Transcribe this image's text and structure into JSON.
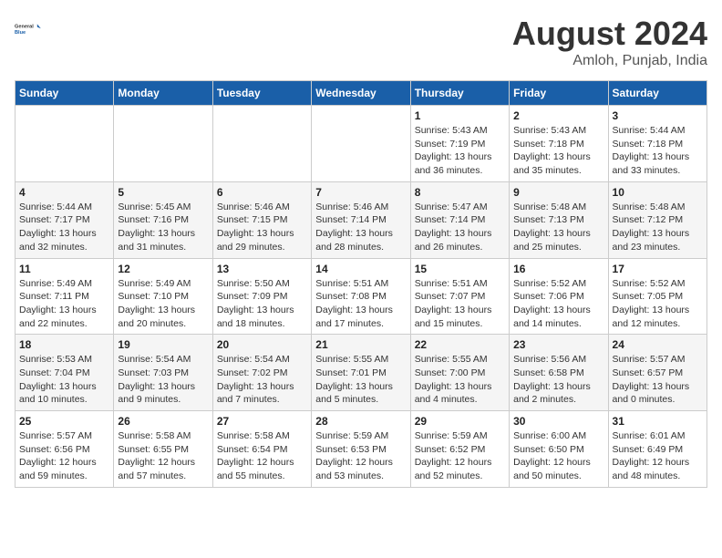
{
  "header": {
    "logo_general": "General",
    "logo_blue": "Blue",
    "title": "August 2024",
    "location": "Amloh, Punjab, India"
  },
  "days_of_week": [
    "Sunday",
    "Monday",
    "Tuesday",
    "Wednesday",
    "Thursday",
    "Friday",
    "Saturday"
  ],
  "weeks": [
    [
      {
        "day": "",
        "content": ""
      },
      {
        "day": "",
        "content": ""
      },
      {
        "day": "",
        "content": ""
      },
      {
        "day": "",
        "content": ""
      },
      {
        "day": "1",
        "content": "Sunrise: 5:43 AM\nSunset: 7:19 PM\nDaylight: 13 hours\nand 36 minutes."
      },
      {
        "day": "2",
        "content": "Sunrise: 5:43 AM\nSunset: 7:18 PM\nDaylight: 13 hours\nand 35 minutes."
      },
      {
        "day": "3",
        "content": "Sunrise: 5:44 AM\nSunset: 7:18 PM\nDaylight: 13 hours\nand 33 minutes."
      }
    ],
    [
      {
        "day": "4",
        "content": "Sunrise: 5:44 AM\nSunset: 7:17 PM\nDaylight: 13 hours\nand 32 minutes."
      },
      {
        "day": "5",
        "content": "Sunrise: 5:45 AM\nSunset: 7:16 PM\nDaylight: 13 hours\nand 31 minutes."
      },
      {
        "day": "6",
        "content": "Sunrise: 5:46 AM\nSunset: 7:15 PM\nDaylight: 13 hours\nand 29 minutes."
      },
      {
        "day": "7",
        "content": "Sunrise: 5:46 AM\nSunset: 7:14 PM\nDaylight: 13 hours\nand 28 minutes."
      },
      {
        "day": "8",
        "content": "Sunrise: 5:47 AM\nSunset: 7:14 PM\nDaylight: 13 hours\nand 26 minutes."
      },
      {
        "day": "9",
        "content": "Sunrise: 5:48 AM\nSunset: 7:13 PM\nDaylight: 13 hours\nand 25 minutes."
      },
      {
        "day": "10",
        "content": "Sunrise: 5:48 AM\nSunset: 7:12 PM\nDaylight: 13 hours\nand 23 minutes."
      }
    ],
    [
      {
        "day": "11",
        "content": "Sunrise: 5:49 AM\nSunset: 7:11 PM\nDaylight: 13 hours\nand 22 minutes."
      },
      {
        "day": "12",
        "content": "Sunrise: 5:49 AM\nSunset: 7:10 PM\nDaylight: 13 hours\nand 20 minutes."
      },
      {
        "day": "13",
        "content": "Sunrise: 5:50 AM\nSunset: 7:09 PM\nDaylight: 13 hours\nand 18 minutes."
      },
      {
        "day": "14",
        "content": "Sunrise: 5:51 AM\nSunset: 7:08 PM\nDaylight: 13 hours\nand 17 minutes."
      },
      {
        "day": "15",
        "content": "Sunrise: 5:51 AM\nSunset: 7:07 PM\nDaylight: 13 hours\nand 15 minutes."
      },
      {
        "day": "16",
        "content": "Sunrise: 5:52 AM\nSunset: 7:06 PM\nDaylight: 13 hours\nand 14 minutes."
      },
      {
        "day": "17",
        "content": "Sunrise: 5:52 AM\nSunset: 7:05 PM\nDaylight: 13 hours\nand 12 minutes."
      }
    ],
    [
      {
        "day": "18",
        "content": "Sunrise: 5:53 AM\nSunset: 7:04 PM\nDaylight: 13 hours\nand 10 minutes."
      },
      {
        "day": "19",
        "content": "Sunrise: 5:54 AM\nSunset: 7:03 PM\nDaylight: 13 hours\nand 9 minutes."
      },
      {
        "day": "20",
        "content": "Sunrise: 5:54 AM\nSunset: 7:02 PM\nDaylight: 13 hours\nand 7 minutes."
      },
      {
        "day": "21",
        "content": "Sunrise: 5:55 AM\nSunset: 7:01 PM\nDaylight: 13 hours\nand 5 minutes."
      },
      {
        "day": "22",
        "content": "Sunrise: 5:55 AM\nSunset: 7:00 PM\nDaylight: 13 hours\nand 4 minutes."
      },
      {
        "day": "23",
        "content": "Sunrise: 5:56 AM\nSunset: 6:58 PM\nDaylight: 13 hours\nand 2 minutes."
      },
      {
        "day": "24",
        "content": "Sunrise: 5:57 AM\nSunset: 6:57 PM\nDaylight: 13 hours\nand 0 minutes."
      }
    ],
    [
      {
        "day": "25",
        "content": "Sunrise: 5:57 AM\nSunset: 6:56 PM\nDaylight: 12 hours\nand 59 minutes."
      },
      {
        "day": "26",
        "content": "Sunrise: 5:58 AM\nSunset: 6:55 PM\nDaylight: 12 hours\nand 57 minutes."
      },
      {
        "day": "27",
        "content": "Sunrise: 5:58 AM\nSunset: 6:54 PM\nDaylight: 12 hours\nand 55 minutes."
      },
      {
        "day": "28",
        "content": "Sunrise: 5:59 AM\nSunset: 6:53 PM\nDaylight: 12 hours\nand 53 minutes."
      },
      {
        "day": "29",
        "content": "Sunrise: 5:59 AM\nSunset: 6:52 PM\nDaylight: 12 hours\nand 52 minutes."
      },
      {
        "day": "30",
        "content": "Sunrise: 6:00 AM\nSunset: 6:50 PM\nDaylight: 12 hours\nand 50 minutes."
      },
      {
        "day": "31",
        "content": "Sunrise: 6:01 AM\nSunset: 6:49 PM\nDaylight: 12 hours\nand 48 minutes."
      }
    ]
  ]
}
